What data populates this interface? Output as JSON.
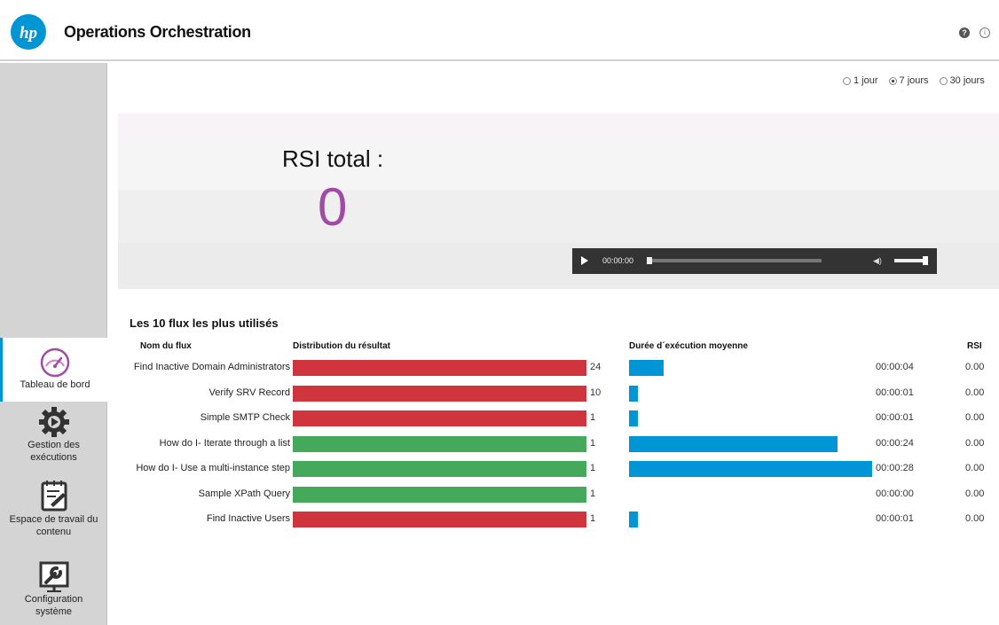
{
  "header": {
    "title": "Operations Orchestration",
    "help_glyph": "?",
    "info_glyph": "i"
  },
  "colors": {
    "red": "#d0343c",
    "green": "#45a95c",
    "blue": "#0096d6",
    "purple": "#a14aa6",
    "hp_blue": "#0096d6"
  },
  "sidebar": {
    "items": [
      {
        "label": "Tableau de bord",
        "icon": "speedometer-icon",
        "active": true
      },
      {
        "label": "Gestion des exécutions",
        "icon": "gear-play-icon",
        "active": false
      },
      {
        "label": "Espace de travail du contenu",
        "icon": "edit-document-icon",
        "active": false
      },
      {
        "label": "Configuration système",
        "icon": "wrench-screen-icon",
        "active": false
      }
    ]
  },
  "time_range": {
    "options": [
      {
        "label": "1 jour",
        "checked": false
      },
      {
        "label": "7 jours",
        "checked": true
      },
      {
        "label": "30 jours",
        "checked": false
      }
    ]
  },
  "roi": {
    "title": "RSI total :",
    "value": "0"
  },
  "player": {
    "time": "00:00:00"
  },
  "top_flows": {
    "title": "Les 10 flux les plus utilisés",
    "columns": {
      "name": "Nom du flux",
      "result": "Distribution du résultat",
      "duration": "Durée d´exécution moyenne",
      "roi": "RSI"
    },
    "max_duration_seconds": 28,
    "rows": [
      {
        "name": "Find Inactive Domain Administrators",
        "count": "24",
        "result": "red",
        "duration": "00:00:04",
        "duration_seconds": 4,
        "roi": "0.00"
      },
      {
        "name": "Verify SRV Record",
        "count": "10",
        "result": "red",
        "duration": "00:00:01",
        "duration_seconds": 1,
        "roi": "0.00"
      },
      {
        "name": "Simple SMTP Check",
        "count": "1",
        "result": "red",
        "duration": "00:00:01",
        "duration_seconds": 1,
        "roi": "0.00"
      },
      {
        "name": "How do I- Iterate through a list",
        "count": "1",
        "result": "green",
        "duration": "00:00:24",
        "duration_seconds": 24,
        "roi": "0.00"
      },
      {
        "name": "How do I- Use a multi-instance step",
        "count": "1",
        "result": "green",
        "duration": "00:00:28",
        "duration_seconds": 28,
        "roi": "0.00"
      },
      {
        "name": "Sample XPath Query",
        "count": "1",
        "result": "green",
        "duration": "00:00:00",
        "duration_seconds": 0,
        "roi": "0.00"
      },
      {
        "name": "Find Inactive Users",
        "count": "1",
        "result": "red",
        "duration": "00:00:01",
        "duration_seconds": 1,
        "roi": "0.00"
      }
    ]
  }
}
